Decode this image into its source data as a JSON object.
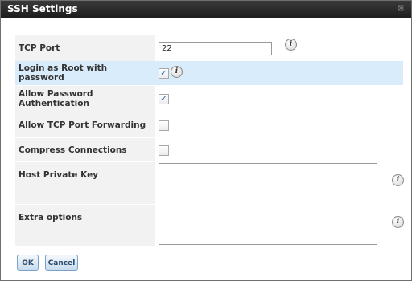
{
  "window": {
    "title": "SSH Settings",
    "close_glyph": "⊠"
  },
  "form": {
    "tcp_port": {
      "label": "TCP Port",
      "value": "22",
      "info_icon": "info-icon"
    },
    "login_root": {
      "label": "Login as Root with password",
      "checked": true
    },
    "allow_password_auth": {
      "label": "Allow Password Authentication",
      "checked": true
    },
    "allow_tcp_forwarding": {
      "label": "Allow TCP Port Forwarding",
      "checked": false
    },
    "compress_connections": {
      "label": "Compress Connections",
      "checked": false
    },
    "host_private_key": {
      "label": "Host Private Key",
      "value": ""
    },
    "extra_options": {
      "label": "Extra options",
      "value": ""
    }
  },
  "buttons": {
    "ok": "OK",
    "cancel": "Cancel"
  },
  "icons": {
    "info_glyph": "i",
    "check_glyph": "✓"
  },
  "colors": {
    "highlight_row": "#d9ecfb",
    "titlebar": "#262626",
    "check": "#2a6ab8"
  }
}
